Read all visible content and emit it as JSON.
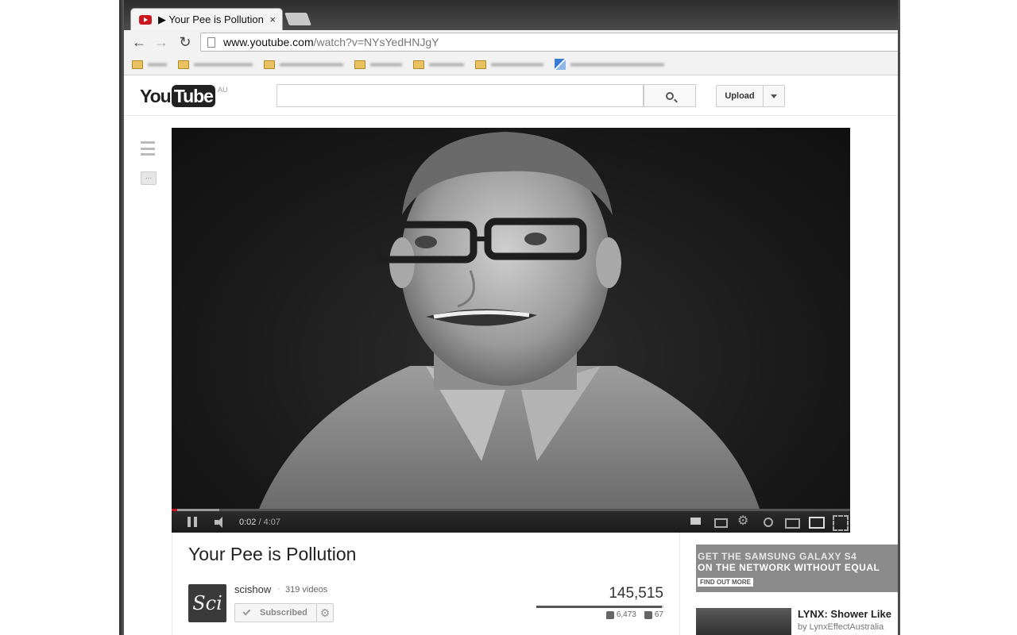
{
  "browser": {
    "tab": {
      "title": "▶ Your Pee is Pollution",
      "close": "×"
    },
    "address": {
      "host": "www.youtube.com",
      "path": "/watch?v=NYsYedHNJgY"
    },
    "bookmarks": [
      {
        "label": "",
        "icon": "folder-icon"
      },
      {
        "label": "",
        "icon": "folder-icon"
      },
      {
        "label": "",
        "icon": "folder-icon"
      },
      {
        "label": "",
        "icon": "folder-icon"
      },
      {
        "label": "",
        "icon": "folder-icon"
      },
      {
        "label": "",
        "icon": "folder-icon"
      },
      {
        "label": "",
        "icon": "image-icon"
      }
    ]
  },
  "youtube": {
    "logo": {
      "you": "You",
      "tube": "Tube",
      "region": "AU"
    },
    "search": {
      "placeholder": ""
    },
    "upload_label": "Upload"
  },
  "player": {
    "current_time": "0:02",
    "duration": "4:07",
    "progress_fraction": 0.008,
    "buffered_fraction": 0.07
  },
  "video": {
    "title": "Your Pee is Pollution",
    "channel": "scishow",
    "channel_separator": "·",
    "video_count": "319 videos",
    "subscribed_label": "Subscribed",
    "views": "145,515",
    "likes": "6,473",
    "dislikes": "67",
    "like_fraction": 0.99
  },
  "sidebar": {
    "ad": {
      "line1": "GET THE SAMSUNG GALAXY S4",
      "line2": "ON THE NETWORK WITHOUT EQUAL",
      "cta": "FIND OUT MORE"
    },
    "related": {
      "title": "LYNX: Shower Like",
      "by": "by LynxEffectAustralia"
    }
  }
}
